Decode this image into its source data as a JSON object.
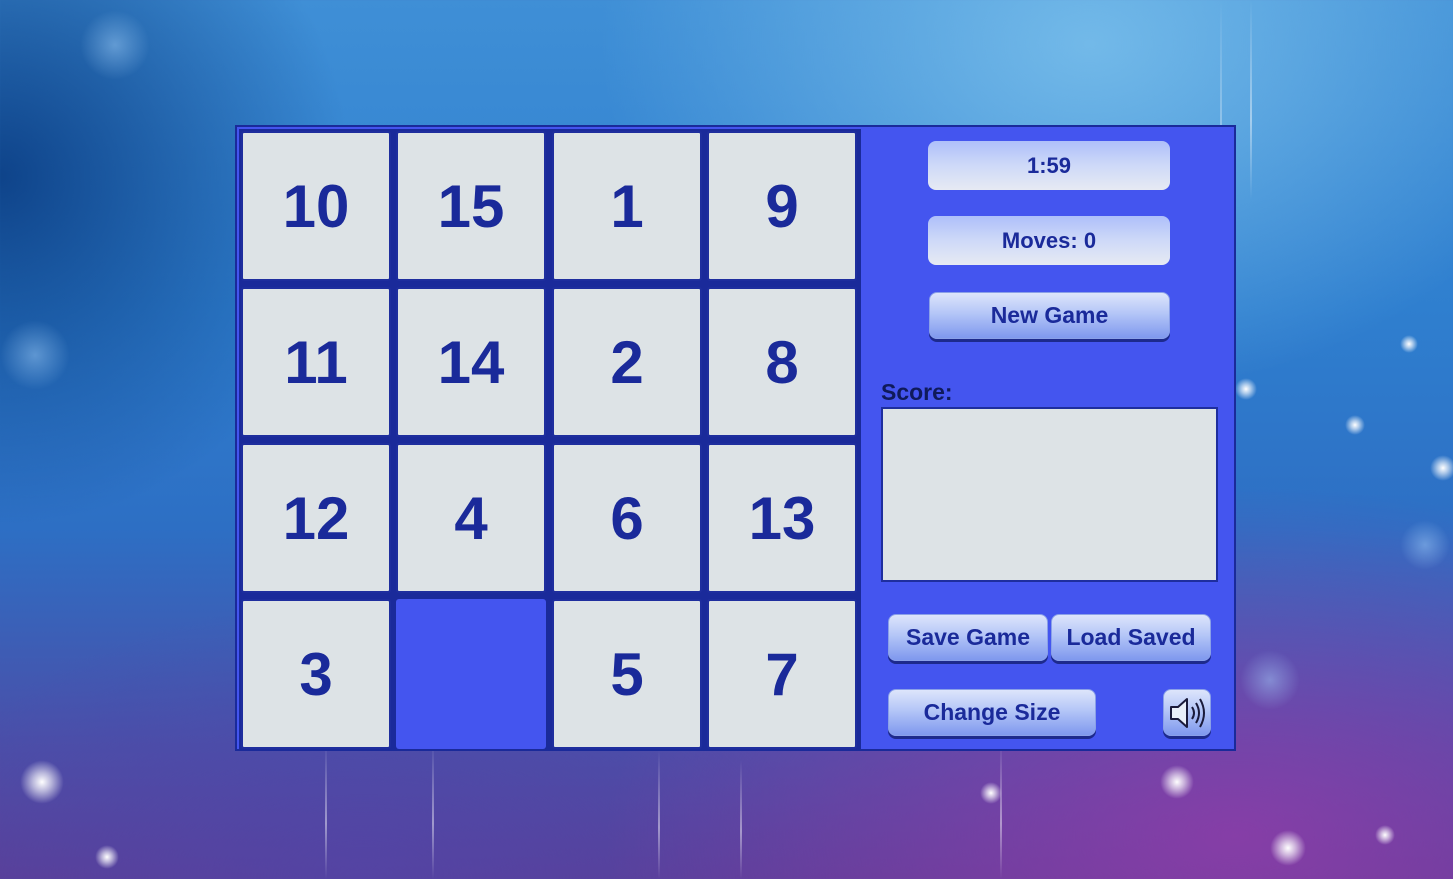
{
  "tiles": [
    {
      "label": "10"
    },
    {
      "label": "15"
    },
    {
      "label": "1"
    },
    {
      "label": "9"
    },
    {
      "label": "11"
    },
    {
      "label": "14"
    },
    {
      "label": "2"
    },
    {
      "label": "8"
    },
    {
      "label": "12"
    },
    {
      "label": "4"
    },
    {
      "label": "6"
    },
    {
      "label": "13"
    },
    {
      "label": "3"
    },
    {
      "label": ""
    },
    {
      "label": "5"
    },
    {
      "label": "7"
    }
  ],
  "panel": {
    "timer": "1:59",
    "moves": "Moves: 0",
    "new_game_label": "New Game",
    "score_label": "Score:",
    "score_value": "",
    "save_game_label": "Save Game",
    "load_saved_label": "Load Saved",
    "change_size_label": "Change Size",
    "sound_icon": "speaker-icon"
  },
  "colors": {
    "panel_bg": "#4455ef",
    "tile_bg": "#dde3e6",
    "text": "#1a2a9a"
  }
}
